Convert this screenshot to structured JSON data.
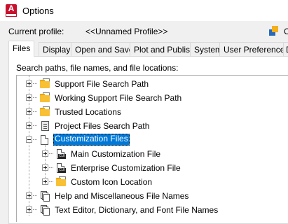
{
  "window": {
    "title": "Options"
  },
  "profile": {
    "label": "Current profile:",
    "value": "<<Unnamed Profile>>",
    "cut_text": "C"
  },
  "tabs": [
    {
      "label": "Files",
      "active": true
    },
    {
      "label": "Display"
    },
    {
      "label": "Open and Save"
    },
    {
      "label": "Plot and Publish"
    },
    {
      "label": "System"
    },
    {
      "label": "User Preferences"
    },
    {
      "label": "D"
    }
  ],
  "files": {
    "section_label": "Search paths, file names, and file locations:",
    "tree": [
      {
        "label": "Support File Search Path",
        "icon": "folder-stack-icon",
        "expanded": false,
        "level": 0
      },
      {
        "label": "Working Support File Search Path",
        "icon": "folder-stack-icon",
        "expanded": false,
        "level": 0
      },
      {
        "label": "Trusted Locations",
        "icon": "folder-stack-icon",
        "expanded": false,
        "level": 0
      },
      {
        "label": "Project Files Search Path",
        "icon": "project-icon",
        "expanded": false,
        "level": 0
      },
      {
        "label": "Customization Files",
        "icon": "document-icon",
        "expanded": true,
        "selected": true,
        "level": 0
      },
      {
        "label": "Main Customization File",
        "icon": "cui-file-icon",
        "expanded": false,
        "level": 1
      },
      {
        "label": "Enterprise Customization File",
        "icon": "cui-file-icon",
        "expanded": false,
        "level": 1
      },
      {
        "label": "Custom Icon Location",
        "icon": "folder-stack-icon",
        "expanded": false,
        "level": 1
      },
      {
        "label": "Help and Miscellaneous File Names",
        "icon": "documents-stack-icon",
        "expanded": false,
        "level": 0
      },
      {
        "label": "Text Editor, Dictionary, and Font File Names",
        "icon": "documents-stack-icon",
        "expanded": false,
        "level": 0
      }
    ]
  },
  "colors": {
    "selection": "#0078d7",
    "folder": "#f7c035",
    "app_icon": "#c8102e"
  }
}
